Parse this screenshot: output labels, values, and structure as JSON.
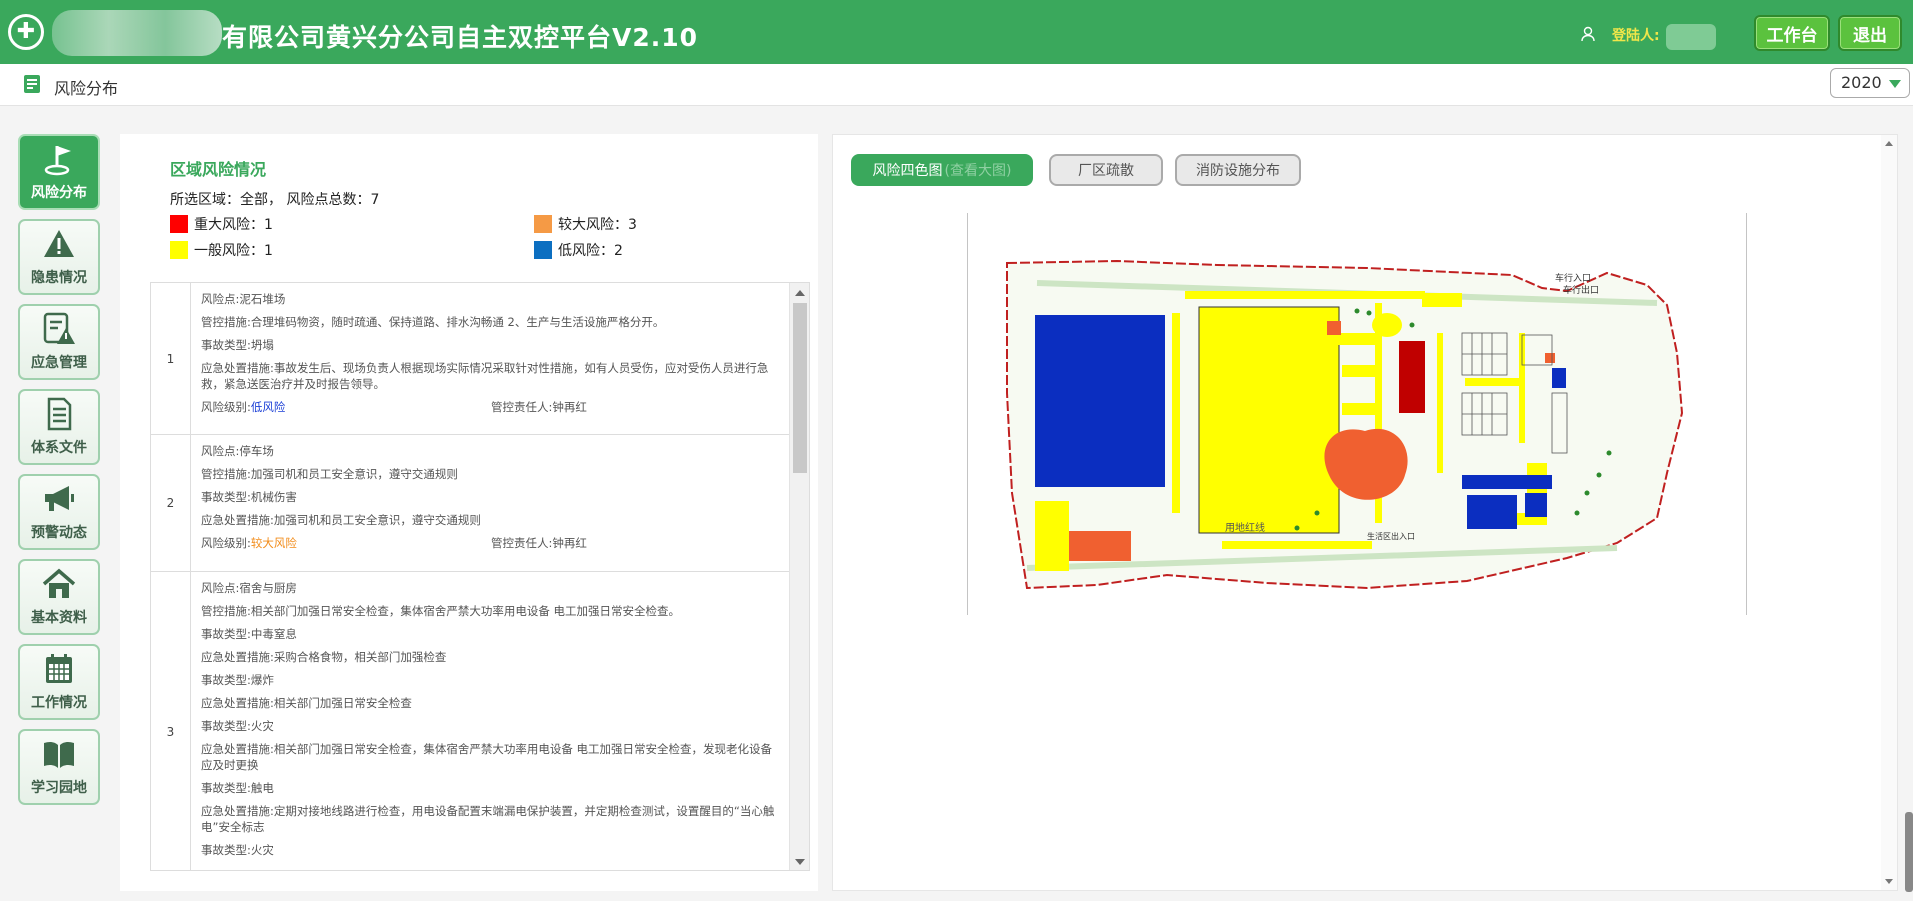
{
  "header": {
    "title": "有限公司黄兴分公司自主双控平台V2.10",
    "login_label": "登陆人:",
    "workbench_label": "工作台",
    "logout_label": "退出"
  },
  "subbar": {
    "title": "风险分布",
    "year": "2020"
  },
  "nav": {
    "items": [
      {
        "label": "风险分布",
        "icon": "flag-icon",
        "active": true
      },
      {
        "label": "隐患情况",
        "icon": "warning-icon"
      },
      {
        "label": "应急管理",
        "icon": "emergency-doc-icon"
      },
      {
        "label": "体系文件",
        "icon": "document-icon"
      },
      {
        "label": "预警动态",
        "icon": "megaphone-icon"
      },
      {
        "label": "基本资料",
        "icon": "home-icon"
      },
      {
        "label": "工作情况",
        "icon": "calendar-icon"
      },
      {
        "label": "学习园地",
        "icon": "book-icon"
      }
    ]
  },
  "area": {
    "title": "区域风险情况",
    "summary": "所选区域：全部， 风险点总数：7",
    "legend": [
      {
        "label": "重大风险：1",
        "color": "#ff0000"
      },
      {
        "label": "较大风险：3",
        "color": "#f59a45"
      },
      {
        "label": "一般风险：1",
        "color": "#ffff00"
      },
      {
        "label": "低风险：2",
        "color": "#0c6fc1"
      }
    ]
  },
  "risk_list": [
    {
      "num": "1",
      "point": "风险点:泥石堆场",
      "measures": "管控措施:合理堆码物资，随时疏通、保持道路、排水沟畅通 2、生产与生活设施严格分开。",
      "accident": "事故类型:坍塌",
      "emergency": "应急处置措施:事故发生后、现场负责人根据现场实际情况采取针对性措施，如有人员受伤，应对受伤人员进行急救，紧急送医治疗并及时报告领导。",
      "level_prefix": "风险级别:",
      "level": "低风险",
      "owner": "管控责任人:钟再红"
    },
    {
      "num": "2",
      "point": "风险点:停车场",
      "measures": "管控措施:加强司机和员工安全意识，遵守交通规则",
      "accident": "事故类型:机械伤害",
      "emergency": "应急处置措施:加强司机和员工安全意识，遵守交通规则",
      "level_prefix": "风险级别:",
      "level": "较大风险",
      "owner": "管控责任人:钟再红"
    },
    {
      "num": "3",
      "point": "风险点:宿舍与厨房",
      "measures": "管控措施:相关部门加强日常安全检查，集体宿舍严禁大功率用电设备 电工加强日常安全检查。",
      "lines": [
        "事故类型:中毒窒息",
        "应急处置措施:采购合格食物，相关部门加强检查",
        "事故类型:爆炸",
        "应急处置措施:相关部门加强日常安全检查",
        "事故类型:火灾",
        "应急处置措施:相关部门加强日常安全检查，集体宿舍严禁大功率用电设备 电工加强日常安全检查，发现老化设备应及时更换",
        "事故类型:触电",
        "应急处置措施:定期对接地线路进行检查，用电设备配置末端漏电保护装置，并定期检查测试，设置醒目的“当心触电”安全标志",
        "事故类型:火灾"
      ]
    }
  ],
  "tabs": {
    "risk_map": "风险四色图",
    "risk_map_sub": "(查看大图)",
    "evacuation": "厂区疏散",
    "fire": "消防设施分布"
  },
  "map_labels": {
    "vehicle_entry": "车行入口",
    "vehicle_exit": "车行出口",
    "boundary": "用地红线",
    "living_gate": "生活区出入口"
  }
}
